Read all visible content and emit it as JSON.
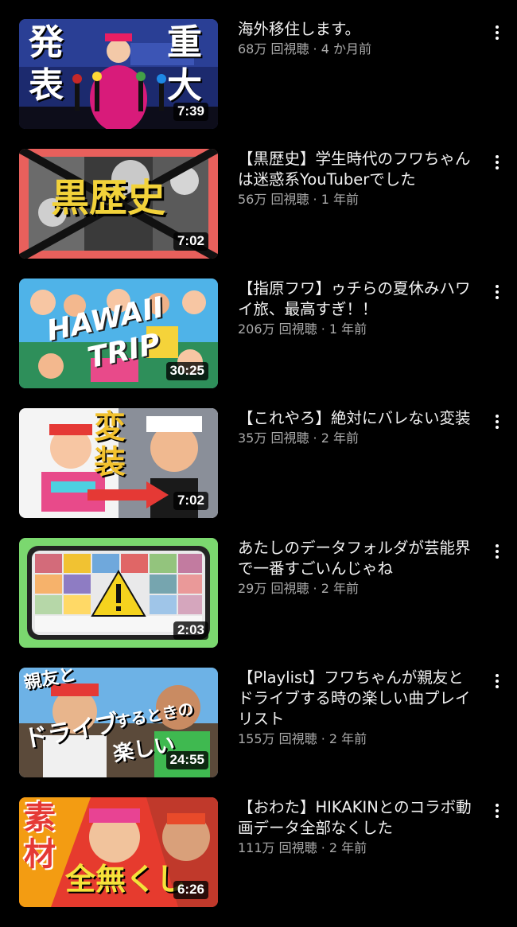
{
  "videos": [
    {
      "title": "海外移住します。",
      "views": "68万 回視聴",
      "age": "4 か月前",
      "duration": "7:39",
      "thumb_text": [
        "発",
        "表",
        "重",
        "大"
      ]
    },
    {
      "title": "【黒歴史】学生時代のフワちゃんは迷惑系YouTuberでした",
      "views": "56万 回視聴",
      "age": "1 年前",
      "duration": "7:02",
      "thumb_text": [
        "黒歴史"
      ]
    },
    {
      "title": "【指原フワ】ゥチらの夏休みハワイ旅、最高すぎ！！",
      "views": "206万 回視聴",
      "age": "1 年前",
      "duration": "30:25",
      "thumb_text": [
        "HAWAII",
        "TRIP"
      ]
    },
    {
      "title": "【これやろ】絶対にバレない変装",
      "views": "35万 回視聴",
      "age": "2 年前",
      "duration": "7:02",
      "thumb_text": [
        "変",
        "装"
      ]
    },
    {
      "title": "あたしのデータフォルダが芸能界で一番すごいんじゃね",
      "views": "29万 回視聴",
      "age": "2 年前",
      "duration": "2:03",
      "thumb_text": []
    },
    {
      "title": "【Playlist】フワちゃんが親友とドライブする時の楽しい曲プレイリスト",
      "views": "155万 回視聴",
      "age": "2 年前",
      "duration": "24:55",
      "thumb_text": [
        "親友と",
        "ドライブ",
        "するときの",
        "楽しい"
      ]
    },
    {
      "title": "【おわた】HIKAKINとのコラボ動画データ全部なくした",
      "views": "111万 回視聴",
      "age": "2 年前",
      "duration": "6:26",
      "thumb_text": [
        "素",
        "材",
        "全無くし"
      ]
    }
  ],
  "separator": " · ",
  "icons": {
    "more": "more-vert-icon",
    "warning": "warning-icon",
    "arrow": "arrow-right-icon"
  },
  "colors": {
    "background": "#000000",
    "title": "#f1f1f1",
    "meta": "#aaaaaa"
  }
}
